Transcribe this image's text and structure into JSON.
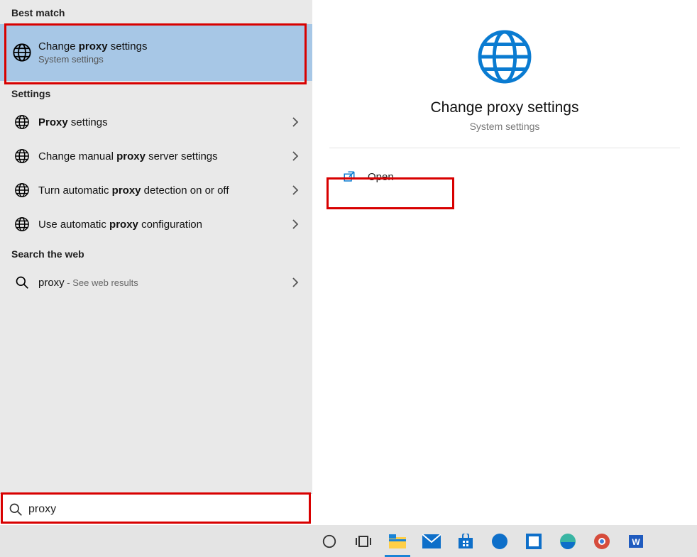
{
  "sections": {
    "best_match": "Best match",
    "settings": "Settings",
    "search_web": "Search the web"
  },
  "best": {
    "title_pre": "Change ",
    "title_hl": "proxy",
    "title_post": " settings",
    "sub": "System settings"
  },
  "settings_items": [
    {
      "pre": "",
      "hl": "Proxy",
      "post": " settings"
    },
    {
      "pre": "Change manual ",
      "hl": "proxy",
      "post": " server settings"
    },
    {
      "pre": "Turn automatic ",
      "hl": "proxy",
      "post": " detection on or off"
    },
    {
      "pre": "Use automatic ",
      "hl": "proxy",
      "post": " configuration"
    }
  ],
  "web": {
    "term": "proxy",
    "hint": " - See web results"
  },
  "preview": {
    "title": "Change proxy settings",
    "sub": "System settings",
    "action": "Open"
  },
  "search": {
    "value": "proxy"
  },
  "taskbar": {
    "icons": [
      "cortana",
      "task-view",
      "file-explorer",
      "mail",
      "store",
      "dell",
      "dell-update",
      "edge",
      "chrome",
      "word"
    ]
  }
}
